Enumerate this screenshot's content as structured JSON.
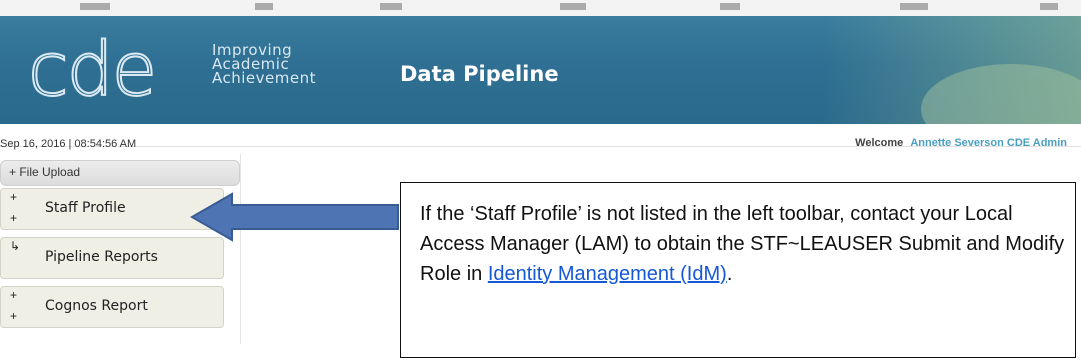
{
  "header": {
    "logo_text": "cde",
    "tagline": [
      "Improving",
      "Academic",
      "Achievement"
    ],
    "app_title": "Data Pipeline"
  },
  "status": {
    "datetime": "Sep 16, 2016 | 08:54:56 AM",
    "welcome_label": "Welcome",
    "user_name": "Annette Severson CDE Admin"
  },
  "sidebar": {
    "header_label": "+ File Upload",
    "items": [
      {
        "label": "Staff Profile"
      },
      {
        "label": "Pipeline Reports"
      },
      {
        "label": "Cognos Report"
      }
    ]
  },
  "callout": {
    "text_before": "If the ‘Staff Profile’ is not listed in the left toolbar, contact your Local Access Manager (LAM) to obtain the STF~LEAUSER Submit and Modify Role in ",
    "link_text": "Identity Management (IdM)",
    "text_after": "."
  },
  "colors": {
    "banner": "#2e6f93",
    "arrow_fill": "#4f74b3",
    "link": "#1558d6",
    "welcome_name": "#4a9fc0"
  }
}
